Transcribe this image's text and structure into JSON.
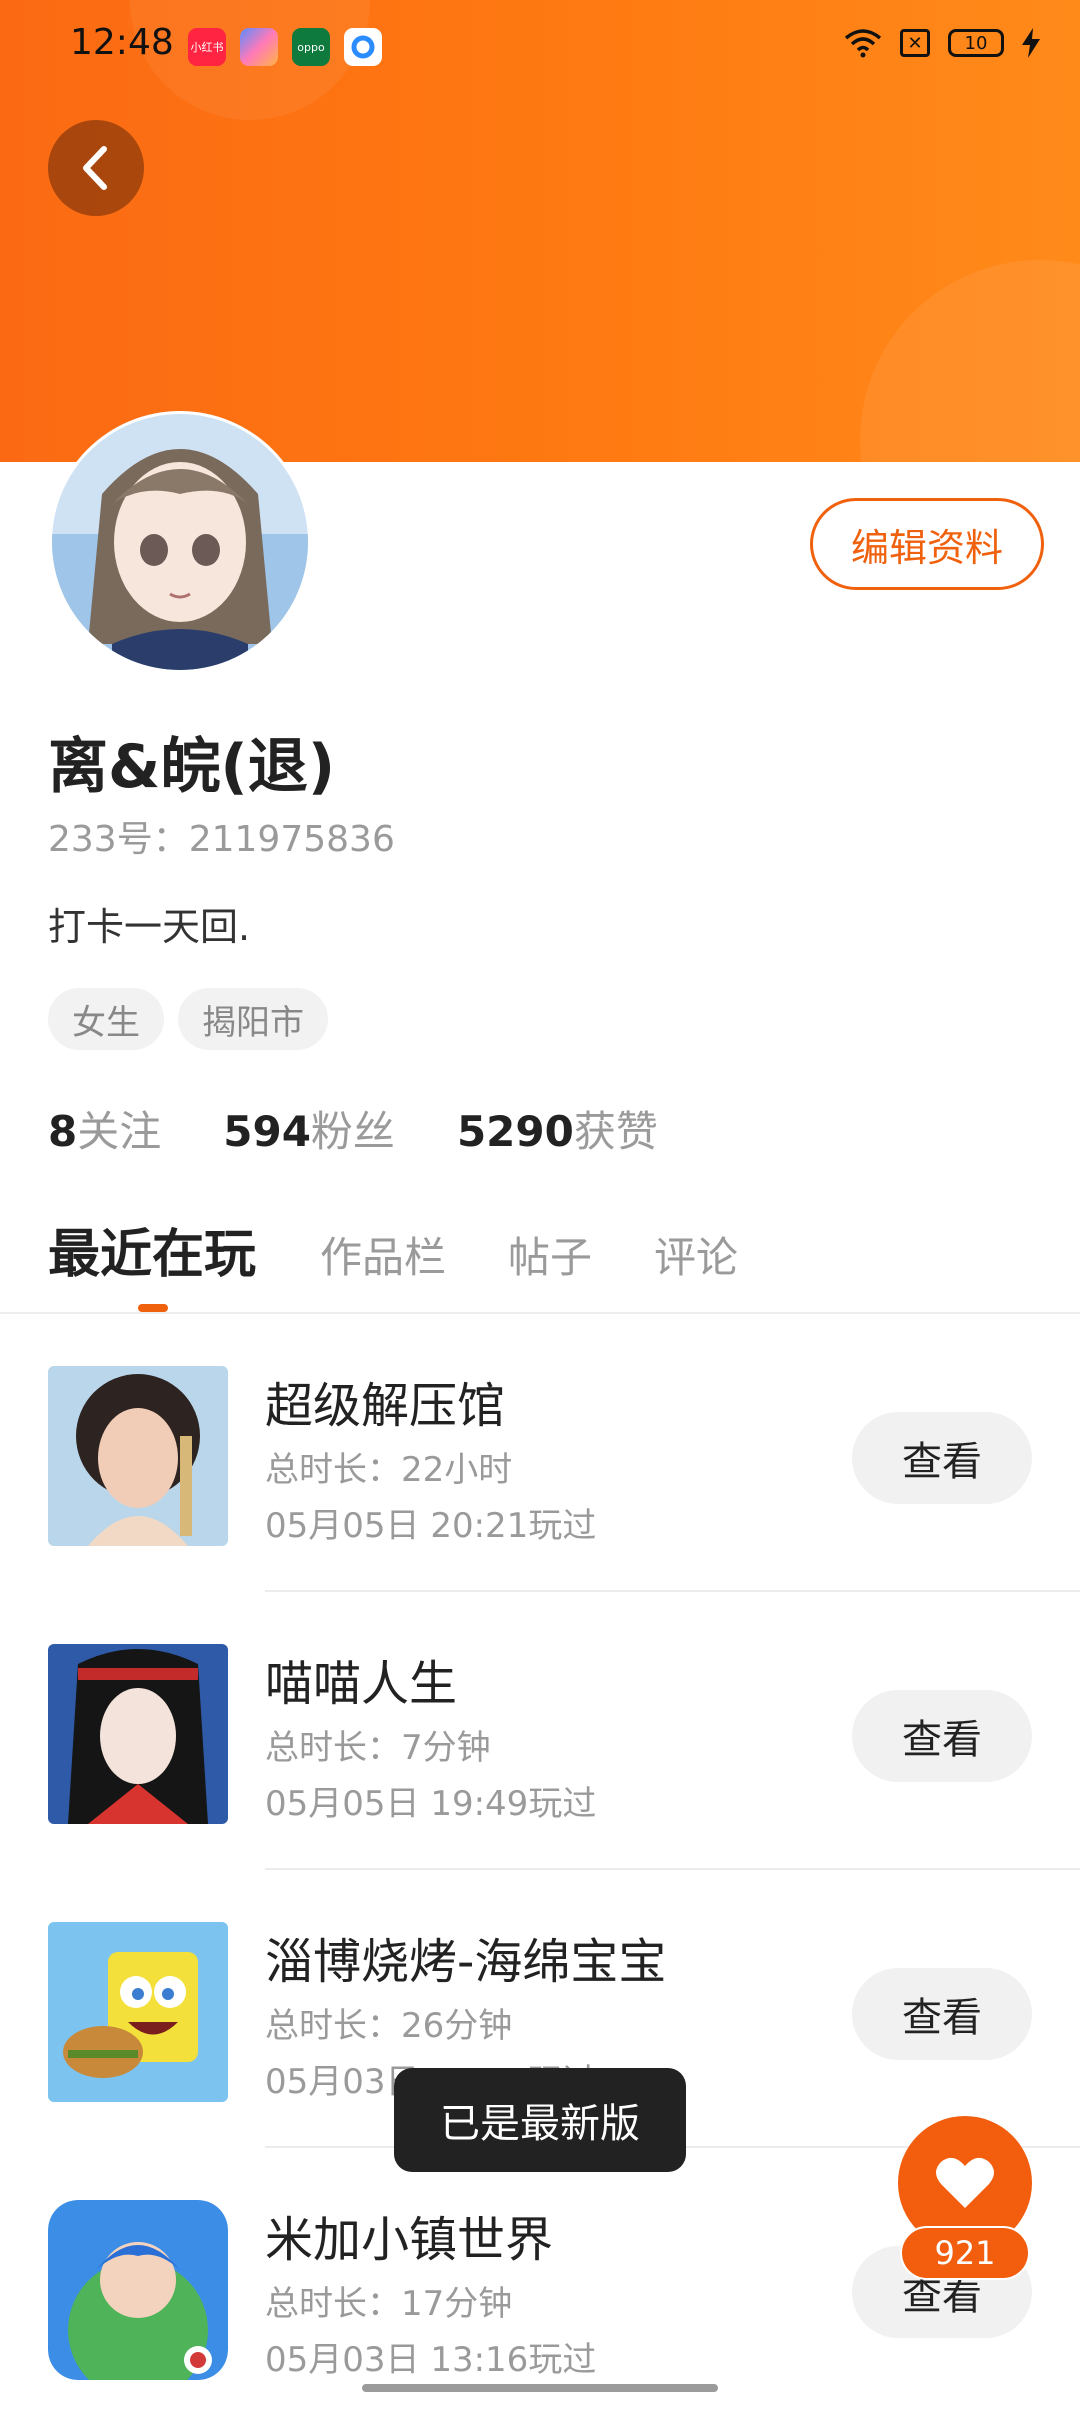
{
  "status_bar": {
    "time": "12:48",
    "apps": [
      {
        "icon": "xiaohongshu-icon",
        "label": "小红书",
        "color": "#ff2442"
      },
      {
        "icon": "shortcut-app-icon",
        "label": "",
        "color": "#6a5cff"
      },
      {
        "icon": "oppo-icon",
        "label": "oppo",
        "color": "#0e7a3d"
      },
      {
        "icon": "app-o-icon",
        "label": "",
        "color": "#2a8cff"
      }
    ],
    "battery": "10"
  },
  "header": {
    "back_icon": "chevron-left-icon",
    "accent_color": "#f0610d"
  },
  "profile": {
    "edit_label": "编辑资料",
    "name": "离&皖(退)",
    "uid": "233号：211975836",
    "bio": "打卡一天回.",
    "tags": [
      "女生",
      "揭阳市"
    ],
    "stats": [
      {
        "num": "8",
        "label": "关注"
      },
      {
        "num": "594",
        "label": "粉丝"
      },
      {
        "num": "5290",
        "label": "获赞"
      }
    ]
  },
  "tabs": [
    "最近在玩",
    "作品栏",
    "帖子",
    "评论"
  ],
  "games": [
    {
      "name": "超级解压馆",
      "duration": "总时长：22小时",
      "played": "05月05日 20:21玩过",
      "button": "查看"
    },
    {
      "name": "喵喵人生",
      "duration": "总时长：7分钟",
      "played": "05月05日 19:49玩过",
      "button": "查看"
    },
    {
      "name": "淄博烧烤-海绵宝宝",
      "duration": "总时长：26分钟",
      "played": "05月03日 13:35玩过",
      "button": "查看"
    },
    {
      "name": "米加小镇世界",
      "duration": "总时长：17分钟",
      "played": "05月03日 13:16玩过",
      "button": "查看"
    }
  ],
  "toast": "已是最新版",
  "like_fab": {
    "icon": "heart-icon",
    "count": "921"
  }
}
